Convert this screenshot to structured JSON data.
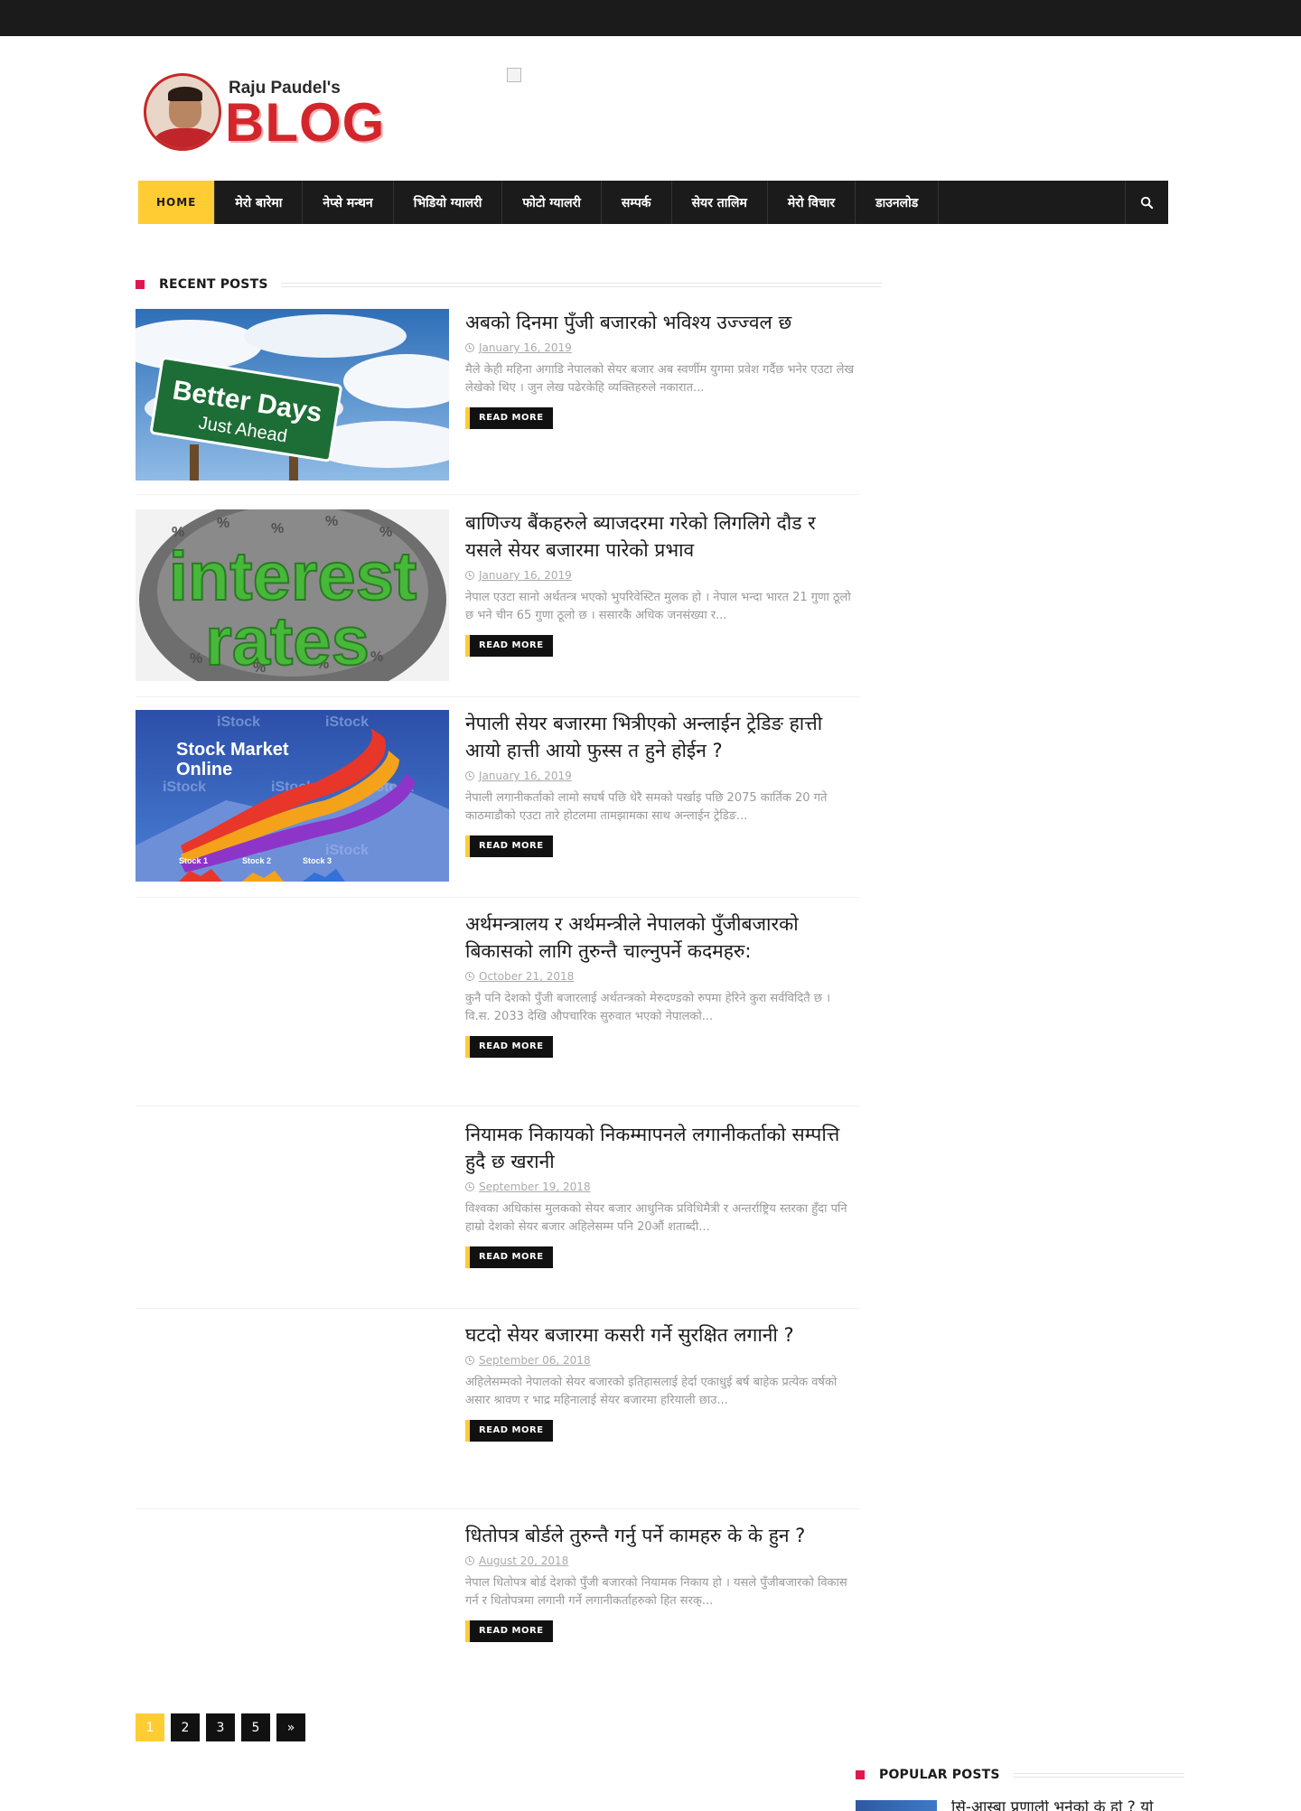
{
  "logo": {
    "name": "Raju Paudel's",
    "word": "BLOG"
  },
  "nav": {
    "items": [
      "HOME",
      "मेरो बारेमा",
      "नेप्से मन्थन",
      "भिडियो ग्यालरी",
      "फोटो ग्यालरी",
      "सम्पर्क",
      "सेयर तालिम",
      "मेरो विचार",
      "डाउनलोड"
    ]
  },
  "recent": {
    "heading": "RECENT POSTS"
  },
  "posts": [
    {
      "title": "अबको दिनमा पुँजी बजारको भविश्य उज्ज्वल छ",
      "date": "January 16, 2019",
      "excerpt": "मैले केही महिना अगाडि नेपालको सेयर बजार अब स्वर्णीम युगमा प्रवेश गर्दैछ भनेर एउटा लेख लेखेको थिए । जुन लेख पढेरकेहि व्यक्तिहरुले नकारात...",
      "thumb_text": [
        "Better Days",
        "Just Ahead"
      ]
    },
    {
      "title": "बाणिज्य बैंकहरुले ब्याजदरमा गरेको लिगलिगे दौड र यसले सेयर बजारमा पारेको प्रभाव",
      "date": "January 16, 2019",
      "excerpt": "नेपाल एउटा सानो अर्थतन्त्र भएको भुपरिवेस्टित मुलक हो । नेपाल भन्दा भारत 21 गुणा ठूलो छ भने चीन 65 गुणा ठूलो छ । ससारकै अधिक जनसंख्या र...",
      "thumb_text": [
        "interest",
        "rates"
      ]
    },
    {
      "title": "नेपाली सेयर बजारमा भित्रीएको अन्लाईन ट्रेडिङ हात्ती आयो हात्ती आयो फुस्स त हुने होईन ?",
      "date": "January 16, 2019",
      "excerpt": "नेपाली लगानीकर्ताको लामो सघर्ष पछि धेरै समको पर्खाइ पछि 2075 कार्तिक 20 गते काठमाडौको एउटा तारे होटलमा तामझामका साथ अन्लाईन ट्रेडिङ...",
      "thumb_text": [
        "Stock Market",
        "Online",
        "iStock",
        "Stock 1",
        "Stock 2",
        "Stock 3"
      ]
    },
    {
      "title": "अर्थमन्त्रालय र अर्थमन्त्रीले नेपालको पुँजीबजारको बिकासको लागि तुरुन्तै चाल्नुपर्ने कदमहरु:",
      "date": "October 21, 2018",
      "excerpt": "कुनै पनि देशको पुँजी बजारलाई अर्थतन्त्रको मेरुदण्डको रुपमा हेरिने कुरा सर्वविदितै छ । वि.स. 2033 देखि औपचारिक सुरुवात भएको नेपालको..."
    },
    {
      "title": "नियामक निकायको निकम्मापनले लगानीकर्ताको सम्पत्ति हुदै छ खरानी",
      "date": "September 19, 2018",
      "excerpt": "विश्वका अधिकांस मुलकको सेयर बजार आधुनिक प्रविधिमैत्री र अन्तर्राष्ट्रिय स्तरका हुँदा पनि हाम्रो देशको सेयर बजार अहिलेसम्म पनि 20औं शताब्दी..."
    },
    {
      "title": "घटदो सेयर बजारमा कसरी गर्ने सुरक्षित लगानी ?",
      "date": "September 06, 2018",
      "excerpt": "अहिलेसम्मको नेपालको सेयर बजारको इतिहासलाई हेर्दा एकाधुई बर्ष बाहेक प्रत्येक वर्षको असार श्रावण र भाद्र महिनालाई सेयर बजारमा हरियाली छाउ..."
    },
    {
      "title": "धितोपत्र बोर्डले तुरुन्तै गर्नु पर्ने कामहरु के के हुन ?",
      "date": "August 20, 2018",
      "excerpt": "नेपाल धितोपत्र बोर्ड देशको पुँजी बजारको नियामक निकाय हो । यसले पुँजीबजारको विकास गर्न र धितोपत्रमा लगानी गर्ने लगानीकर्ताहरुको हित सरक्..."
    }
  ],
  "read_more": "READ MORE",
  "pagination": {
    "pages": [
      "1",
      "2",
      "3",
      "5"
    ],
    "next": "»"
  },
  "popular": {
    "heading": "POPULAR POSTS",
    "first_title": "सि-आस्बा प्रणाली भनेको के हो ? यो"
  },
  "colors": {
    "accent": "#ffcc33",
    "marker": "#e0174f",
    "dark": "#1b1b1b"
  }
}
